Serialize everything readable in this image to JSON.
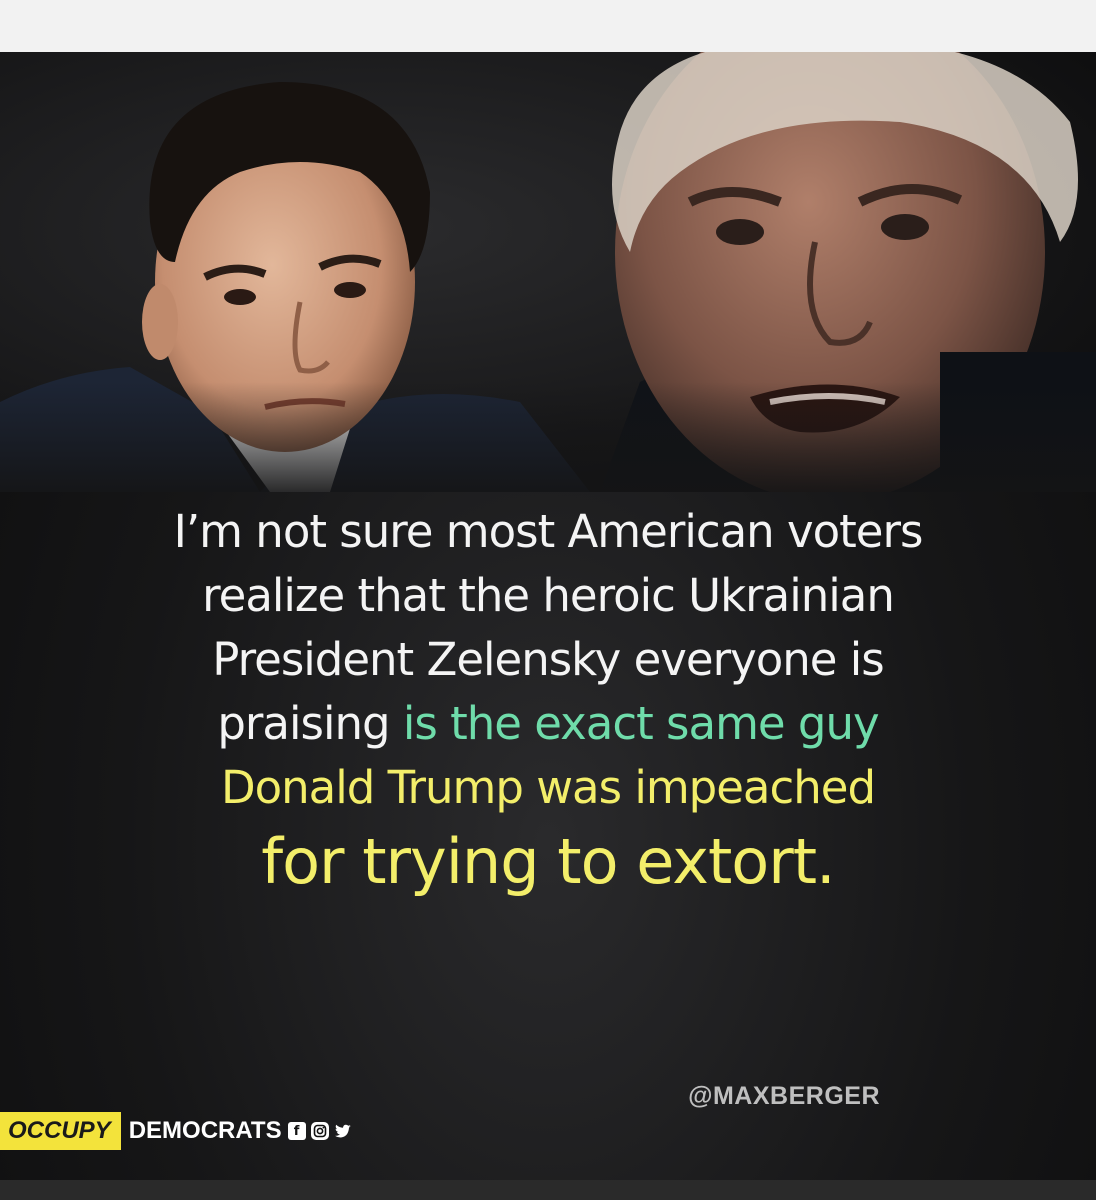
{
  "quote": {
    "line1": "I’m not sure most American voters",
    "line2": "realize that the heroic Ukrainian",
    "line3": "President Zelensky everyone is",
    "line4_white": "praising",
    "line4_green": "is the exact same guy",
    "line5": "Donald Trump was impeached",
    "line6": "for trying to extort."
  },
  "handle": "@MAXBERGER",
  "brand": {
    "occupy": "OCCUPY",
    "democrats": "DEMOCRATS"
  },
  "social_icons": [
    "facebook-icon",
    "instagram-icon",
    "twitter-icon"
  ],
  "colors": {
    "background": "#141415",
    "quote_white": "#f4f4f4",
    "highlight_green": "#6fdcaa",
    "highlight_yellow": "#f3ee6a",
    "brand_yellow": "#f3e33b",
    "handle_gray": "#bfbfbf"
  }
}
